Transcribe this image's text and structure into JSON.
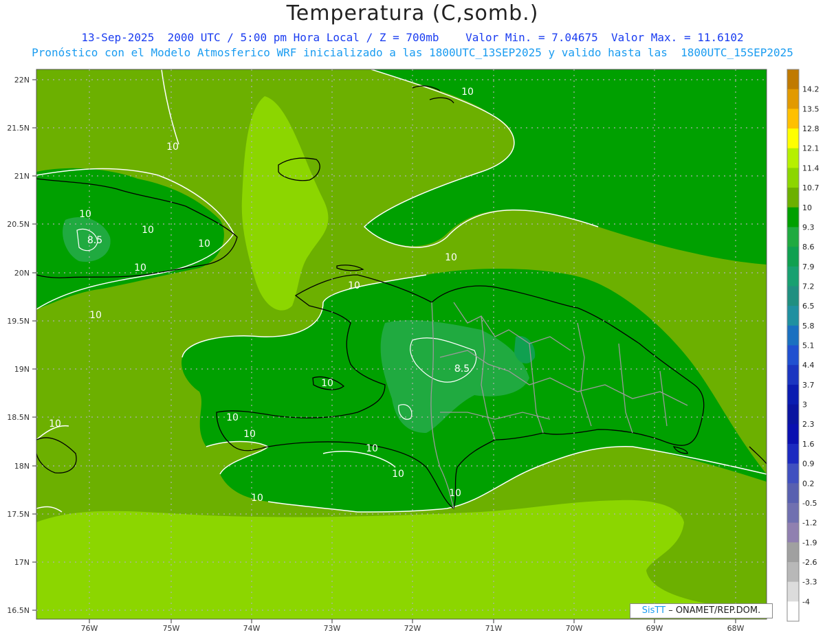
{
  "header": {
    "title": "Temperatura (C,somb.)",
    "line1": "13-Sep-2025  2000 UTC / 5:00 pm Hora Local / Z = 700mb    Valor Min. = 7.04675  Valor Max. = 11.6102",
    "line2": "Pronóstico con el Modelo Atmosferico WRF inicializado a las 1800UTC_13SEP2025 y valido hasta las  1800UTC_15SEP2025"
  },
  "map": {
    "lat_labels": [
      "22N",
      "21.5N",
      "21N",
      "20.5N",
      "20N",
      "19.5N",
      "19N",
      "18.5N",
      "18N",
      "17.5N",
      "17N",
      "16.5N"
    ],
    "lon_labels": [
      "76W",
      "75W",
      "74W",
      "73W",
      "72W",
      "71W",
      "70W",
      "69W",
      "68W"
    ],
    "contour_labels": [
      "10",
      "10",
      "10",
      "10",
      "10",
      "10",
      "10",
      "10",
      "10",
      "10",
      "10",
      "10",
      "10",
      "10",
      "10",
      "10",
      "10",
      "8.5",
      "8.5"
    ]
  },
  "colorbar": {
    "levels": [
      "14.2",
      "13.5",
      "12.8",
      "12.1",
      "11.4",
      "10.7",
      "10",
      "9.3",
      "8.6",
      "7.9",
      "7.2",
      "6.5",
      "5.8",
      "5.1",
      "4.4",
      "3.7",
      "3",
      "2.3",
      "1.6",
      "0.9",
      "0.2",
      "-0.5",
      "-1.2",
      "-1.9",
      "-2.6",
      "-3.3",
      "-4"
    ],
    "colors": [
      "#c07a00",
      "#e29a00",
      "#ffc000",
      "#ffff00",
      "#b6f000",
      "#8cd600",
      "#6cb000",
      "#00a000",
      "#20aa40",
      "#10a050",
      "#18a070",
      "#208f80",
      "#2090a0",
      "#1a70c0",
      "#2050d0",
      "#1a35c0",
      "#0a1cb0",
      "#0a14a0",
      "#0a10b0",
      "#1c2ac0",
      "#4050c0",
      "#5860b0",
      "#7070b0",
      "#9080b0",
      "#a0a0a0",
      "#b8b8b8",
      "#dcdcdc",
      "#ffffff"
    ]
  },
  "credit": {
    "brand": "SisTT",
    "text": " – ONAMET/REP.DOM."
  }
}
